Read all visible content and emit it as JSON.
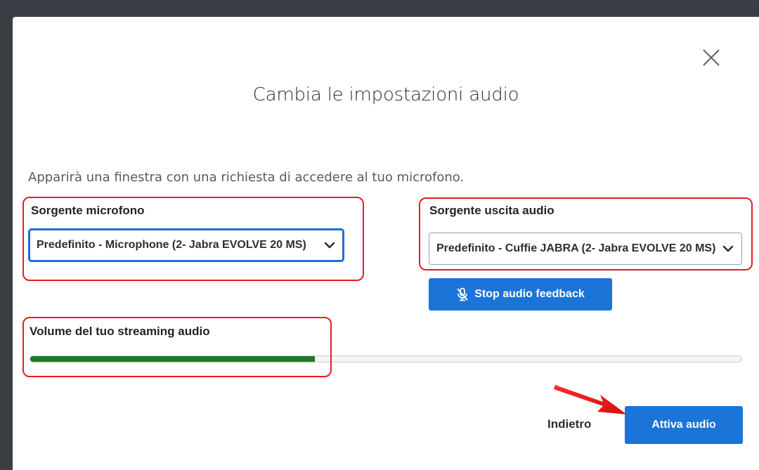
{
  "dialog": {
    "title": "Cambia le impostazioni audio",
    "info_text": "Apparirà una finestra con una richiesta di accedere al tuo microfono.",
    "close_icon": "close-icon"
  },
  "microphone": {
    "label": "Sorgente microfono",
    "selected": "Predefinito - Microphone (2- Jabra EVOLVE 20 MS)"
  },
  "output": {
    "label": "Sorgente uscita audio",
    "selected": "Predefinito - Cuffie JABRA (2- Jabra EVOLVE 20 MS)"
  },
  "feedback_button": {
    "label": "Stop audio feedback",
    "icon": "microphone-off-icon"
  },
  "volume": {
    "label": "Volume del tuo streaming audio",
    "level_percent": 40
  },
  "footer": {
    "back_label": "Indietro",
    "activate_label": "Attiva audio"
  },
  "colors": {
    "accent": "#1b74d8",
    "volume_fill": "#1d7a2a",
    "annotation": "#e81c24"
  }
}
